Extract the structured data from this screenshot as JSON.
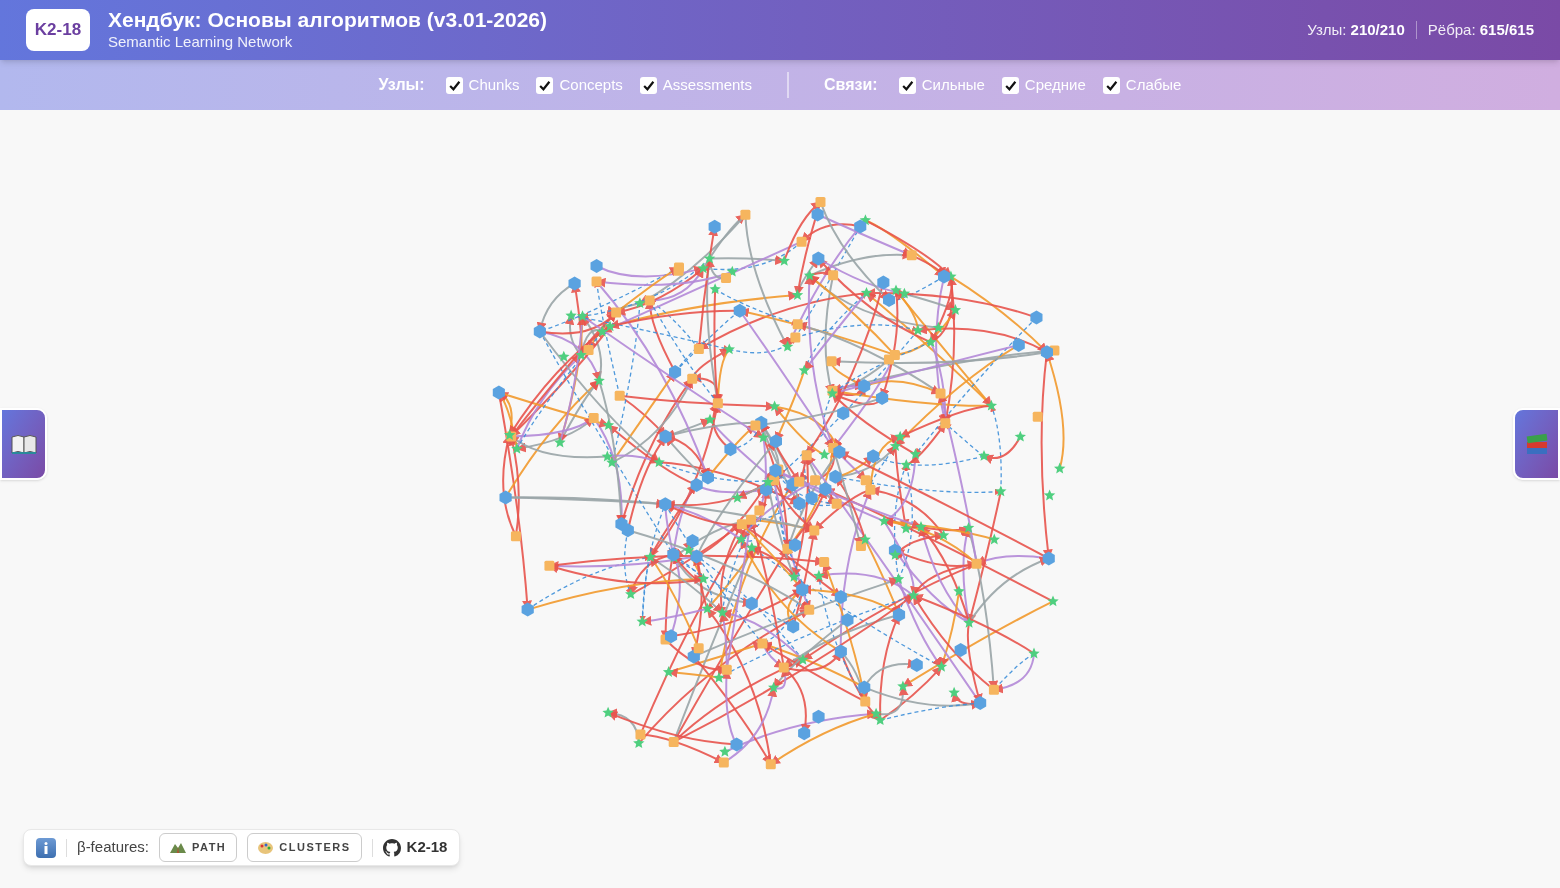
{
  "header": {
    "logo": "K2-18",
    "title": "Хендбук: Основы алгоритмов (v3.01-2026)",
    "subtitle": "Semantic Learning Network",
    "stats": [
      {
        "label": "Узлы:",
        "value": "210/210"
      },
      {
        "label": "Рёбра:",
        "value": "615/615"
      }
    ]
  },
  "filters": [
    {
      "label": "Узлы:",
      "items": [
        {
          "label": "Chunks",
          "checked": true
        },
        {
          "label": "Concepts",
          "checked": true
        },
        {
          "label": "Assessments",
          "checked": true
        }
      ]
    },
    {
      "label": "Связи:",
      "items": [
        {
          "label": "Сильные",
          "checked": true
        },
        {
          "label": "Средние",
          "checked": true
        },
        {
          "label": "Слабые",
          "checked": true
        }
      ]
    }
  ],
  "toolbar": {
    "label": "β-features:",
    "buttons": [
      {
        "label": "PATH",
        "kind": "path"
      },
      {
        "label": "CLUSTERS",
        "kind": "clusters"
      }
    ],
    "repo": "K2-18"
  }
}
